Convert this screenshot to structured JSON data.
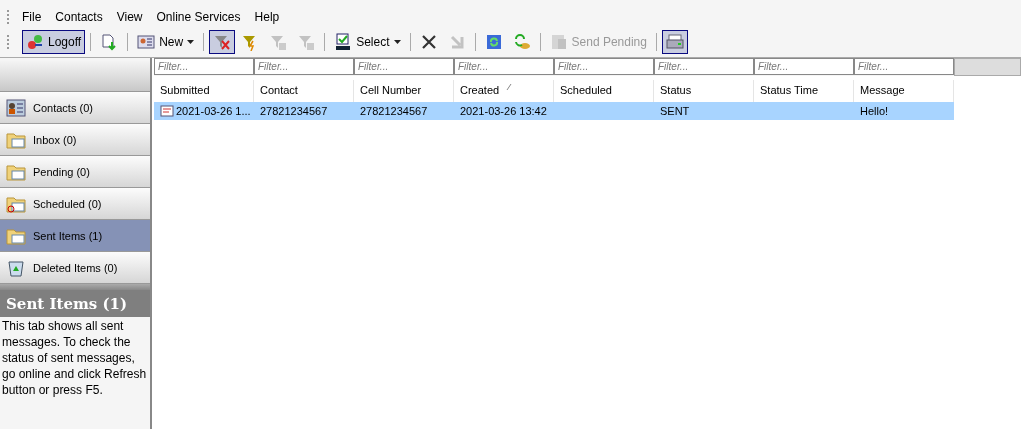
{
  "menu": [
    {
      "label": "File"
    },
    {
      "label": "Contacts"
    },
    {
      "label": "View"
    },
    {
      "label": "Online Services"
    },
    {
      "label": "Help"
    }
  ],
  "toolbar": [
    {
      "kind": "button",
      "label": "Logoff",
      "pressed": true,
      "disabled": false
    },
    {
      "kind": "separator"
    },
    {
      "kind": "button",
      "pressed": false,
      "disabled": false
    },
    {
      "kind": "separator"
    },
    {
      "kind": "dropdown",
      "label": "New",
      "pressed": false,
      "disabled": false
    },
    {
      "kind": "separator"
    },
    {
      "kind": "button",
      "pressed": true,
      "disabled": false
    },
    {
      "kind": "button",
      "pressed": false,
      "disabled": false
    },
    {
      "kind": "button",
      "pressed": false,
      "disabled": true
    },
    {
      "kind": "button",
      "pressed": false,
      "disabled": true
    },
    {
      "kind": "separator"
    },
    {
      "kind": "dropdown",
      "label": "Select",
      "pressed": false,
      "disabled": false
    },
    {
      "kind": "separator"
    },
    {
      "kind": "button",
      "pressed": false,
      "disabled": false
    },
    {
      "kind": "button",
      "pressed": false,
      "disabled": true
    },
    {
      "kind": "separator"
    },
    {
      "kind": "button",
      "pressed": false,
      "disabled": false
    },
    {
      "kind": "button",
      "pressed": false,
      "disabled": false
    },
    {
      "kind": "separator"
    },
    {
      "kind": "button",
      "label": "Send Pending",
      "pressed": false,
      "disabled": true
    },
    {
      "kind": "separator"
    },
    {
      "kind": "button",
      "pressed": true,
      "disabled": false
    }
  ],
  "nav": [
    {
      "label": "Contacts (0)",
      "selected": false
    },
    {
      "label": "Inbox (0)",
      "selected": false
    },
    {
      "label": "Pending (0)",
      "selected": false
    },
    {
      "label": "Scheduled (0)",
      "selected": false
    },
    {
      "label": "Sent Items (1)",
      "selected": true
    },
    {
      "label": "Deleted Items (0)",
      "selected": false
    }
  ],
  "info": {
    "title": "Sent Items (1)",
    "text": "This tab shows all sent messages. To check the status of sent messages, go online and click Refresh button or press F5."
  },
  "table": {
    "filters": [
      {
        "placeholder": "Filter..."
      },
      {
        "placeholder": "Filter..."
      },
      {
        "placeholder": "Filter..."
      },
      {
        "placeholder": "Filter..."
      },
      {
        "placeholder": "Filter..."
      },
      {
        "placeholder": "Filter..."
      },
      {
        "placeholder": "Filter..."
      },
      {
        "placeholder": "Filter..."
      }
    ],
    "columns": [
      {
        "label": "Submitted",
        "sorted": false
      },
      {
        "label": "Contact",
        "sorted": false
      },
      {
        "label": "Cell Number",
        "sorted": false
      },
      {
        "label": "Created",
        "sorted": true
      },
      {
        "label": "Scheduled",
        "sorted": false
      },
      {
        "label": "Status",
        "sorted": false
      },
      {
        "label": "Status Time",
        "sorted": false
      },
      {
        "label": "Message",
        "sorted": false
      }
    ],
    "rows": [
      {
        "selected": true,
        "cells": [
          "2021-03-26 1...",
          "27821234567",
          "27821234567",
          "2021-03-26 13:42",
          "",
          "SENT",
          "",
          "Hello!"
        ]
      }
    ]
  }
}
